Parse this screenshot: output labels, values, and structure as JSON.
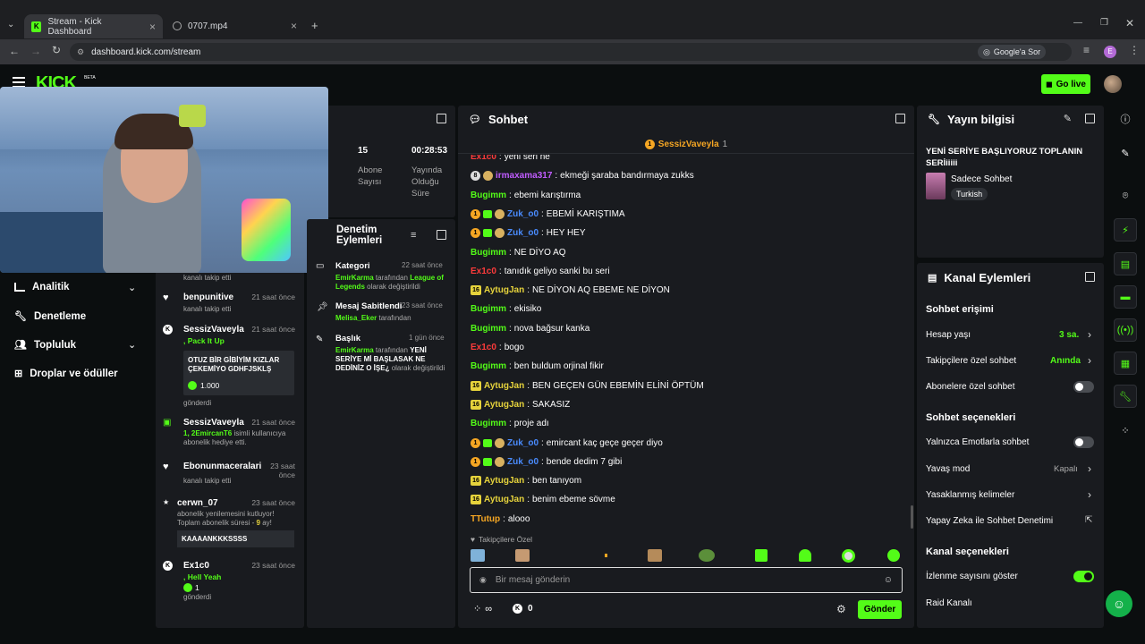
{
  "browser": {
    "tabs": [
      {
        "title": "Stream - Kick Dashboard"
      },
      {
        "title": "0707.mp4"
      }
    ],
    "url": "dashboard.kick.com/stream",
    "google_sor": "Google'a Sor",
    "profile_letter": "E"
  },
  "header": {
    "logo": "KICK",
    "beta": "BETA",
    "go_live": "Go live"
  },
  "nav": [
    {
      "label": "Analitik",
      "icon": "chart-icon"
    },
    {
      "label": "Denetleme",
      "icon": "wrench-icon"
    },
    {
      "label": "Topluluk",
      "icon": "users-icon"
    },
    {
      "label": "Droplar ve ödüller",
      "icon": "gift-icon"
    }
  ],
  "stats": {
    "subs_value": "15",
    "subs_label": "Abone Sayısı",
    "uptime_value": "00:28:53",
    "uptime_label": "Yayında Olduğu Süre"
  },
  "feed": {
    "items": [
      {
        "text": "kanalı takip etti"
      },
      {
        "name": "benpunitive",
        "time": "21 saat önce",
        "text": "kanalı takip etti"
      },
      {
        "name": "SessizVaveyla",
        "time": "21 saat önce",
        "action": ", Pack It Up",
        "message": "OTUZ BİR GİBİYİM KIZLAR ÇEKEMİYO GDHFJSKLŞ",
        "amount": "1.000",
        "tail": "gönderdi"
      },
      {
        "name": "SessizVaveyla",
        "time": "21 saat önce",
        "highlight": "1, 2EmircanT6",
        "text": "isimli kullanıcıya abonelik hediye etti."
      },
      {
        "name": "Ebonunmaceralari",
        "time": "23 saat önce",
        "text": "kanalı takip etti"
      },
      {
        "name": "cerwn_07",
        "time": "23 saat önce",
        "text": "abonelik yenilemesini kutluyor! Toplam abonelik süresi -",
        "months": "9",
        "months_tail": "ay!",
        "message": "KAAAANKKKSSSS"
      },
      {
        "name": "Ex1c0",
        "time": "23 saat önce",
        "action": ", Hell Yeah",
        "amount": "1",
        "tail": "gönderdi"
      }
    ]
  },
  "moderation": {
    "title": "Denetim Eylemleri",
    "items": [
      {
        "title": "Kategori",
        "time": "22 saat önce",
        "actor": "EmirKarma",
        "mid": "tarafından",
        "value": "League of Legends",
        "tail": "olarak değiştirildi"
      },
      {
        "title": "Mesaj Sabitlendi",
        "time": "23 saat önce",
        "actor": "Melisa_Eker",
        "mid": "tarafından",
        "value": "",
        "tail": ""
      },
      {
        "title": "Başlık",
        "time": "1 gün önce",
        "actor": "EmirKarma",
        "mid": "tarafından",
        "value": "YENİ SERİYE Mİ BAŞLASAK NE DEDİNİZ O İŞE¿",
        "tail": "olarak değiştirildi"
      }
    ]
  },
  "chat": {
    "title": "Sohbet",
    "pinned_user": "SessizVaveyla",
    "pinned_count": "1",
    "messages": [
      {
        "user": "Ex1c0",
        "color": "#ff3b3b",
        "text": "yeni seri ne",
        "badges": []
      },
      {
        "user": "irmaxama317",
        "color": "#c05cff",
        "text": "ekmeği şaraba bandırmaya zukks",
        "badges": [
          "8",
          "face"
        ]
      },
      {
        "user": "Bugimm",
        "color": "#53fc18",
        "text": "ebemi karıştırma",
        "badges": []
      },
      {
        "user": "Zuk_o0",
        "color": "#4a8cff",
        "text": "EBEMİ KARIŞTIMA",
        "badges": [
          "1",
          "g",
          "face"
        ]
      },
      {
        "user": "Zuk_o0",
        "color": "#4a8cff",
        "text": "HEY HEY",
        "badges": [
          "1",
          "g",
          "face"
        ]
      },
      {
        "user": "Bugimm",
        "color": "#53fc18",
        "text": "NE DİYO AQ",
        "badges": []
      },
      {
        "user": "Ex1c0",
        "color": "#ff3b3b",
        "text": "tanıdık geliyo sanki bu seri",
        "badges": []
      },
      {
        "user": "AytugJan",
        "color": "#e6d33c",
        "text": "NE DİYON AQ EBEME NE DİYON",
        "badges": [
          "16"
        ]
      },
      {
        "user": "Bugimm",
        "color": "#53fc18",
        "text": "ekisiko",
        "badges": []
      },
      {
        "user": "Bugimm",
        "color": "#53fc18",
        "text": "nova bağsur kanka",
        "badges": []
      },
      {
        "user": "Ex1c0",
        "color": "#ff3b3b",
        "text": "bogo",
        "badges": []
      },
      {
        "user": "Bugimm",
        "color": "#53fc18",
        "text": "ben buldum orjinal fikir",
        "badges": []
      },
      {
        "user": "AytugJan",
        "color": "#e6d33c",
        "text": "BEN GEÇEN GÜN EBEMİN ELİNİ ÖPTÜM",
        "badges": [
          "16"
        ]
      },
      {
        "user": "AytugJan",
        "color": "#e6d33c",
        "text": "SAKASIZ",
        "badges": [
          "16"
        ]
      },
      {
        "user": "Bugimm",
        "color": "#53fc18",
        "text": "proje adı",
        "badges": []
      },
      {
        "user": "Zuk_o0",
        "color": "#4a8cff",
        "text": "emircant kaç geçe geçer diyo",
        "badges": [
          "1",
          "g",
          "face"
        ]
      },
      {
        "user": "Zuk_o0",
        "color": "#4a8cff",
        "text": "bende dedim 7 gibi",
        "badges": [
          "1",
          "g",
          "face"
        ]
      },
      {
        "user": "AytugJan",
        "color": "#e6d33c",
        "text": "ben tanıyom",
        "badges": [
          "16"
        ]
      },
      {
        "user": "AytugJan",
        "color": "#e6d33c",
        "text": "benim ebeme sövme",
        "badges": [
          "16"
        ]
      },
      {
        "user": "TTutup",
        "color": "#f5a623",
        "text": "alooo",
        "badges": []
      }
    ],
    "followers_only": "Takipçilere Özel",
    "input_placeholder": "Bir mesaj gönderin",
    "points": "0",
    "send": "Gönder"
  },
  "stream_info": {
    "title": "Yayın bilgisi",
    "stream_title": "YENİ SERİYE BAŞLIYORUZ TOPLANIN SERİiiiii",
    "category": "Sadece Sohbet",
    "language": "Turkish"
  },
  "channel_actions": {
    "title": "Kanal Eylemleri",
    "chat_access": "Sohbet erişimi",
    "account_age": "Hesap yaşı",
    "account_age_value": "3 sa.",
    "followers_chat": "Takipçilere özel sohbet",
    "followers_chat_value": "Anında",
    "subs_chat": "Abonelere özel sohbet",
    "chat_options": "Sohbet seçenekleri",
    "emote_only": "Yalnızca Emotlarla sohbet",
    "slow_mode": "Yavaş mod",
    "slow_mode_value": "Kapalı",
    "banned_words": "Yasaklanmış kelimeler",
    "ai_moderation": "Yapay Zeka ile Sohbet Denetimi",
    "channel_options": "Kanal seçenekleri",
    "show_viewers": "İzlenme sayısını göster",
    "raid": "Raid Kanalı"
  },
  "colors": {
    "accent": "#53fc18",
    "panel": "#191b1f",
    "bg": "#0b0e0f"
  }
}
